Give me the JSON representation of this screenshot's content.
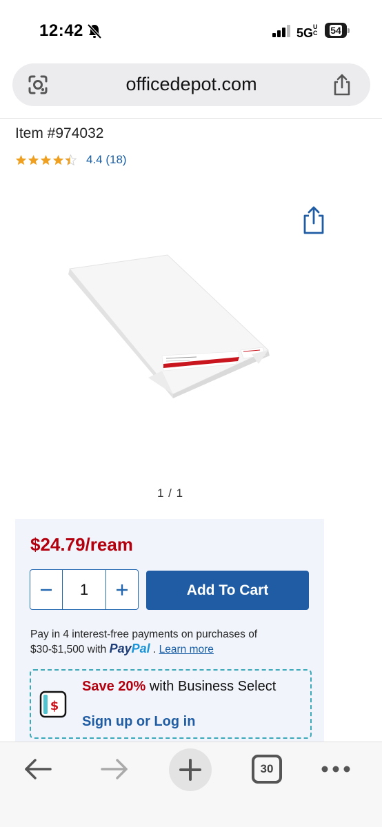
{
  "status": {
    "time": "12:42",
    "network": "5G",
    "network_suffix": "UC",
    "battery": "54"
  },
  "browser": {
    "url": "officedepot.com"
  },
  "product": {
    "item_number": "Item #974032",
    "rating_value": 4.4,
    "rating_text": "4.4 (18)",
    "gallery_count": "1 / 1"
  },
  "buy_box": {
    "price": "$24.79/ream",
    "quantity": "1",
    "add_to_cart_label": "Add To Cart",
    "paypal_text_before": "Pay in 4 interest-free payments on purchases of $30-$1,500 with",
    "paypal_brand_pay": "Pay",
    "paypal_brand_pal": "Pal",
    "paypal_separator": ".",
    "learn_more_label": "Learn more"
  },
  "promo": {
    "save_label": "Save 20%",
    "line_rest": " with Business Select",
    "cta_label": "Sign up or Log in"
  },
  "toolbar": {
    "tab_count": "30"
  },
  "colors": {
    "price_red": "#b3000f",
    "brand_blue": "#1f5ca3",
    "star_orange": "#f0a020",
    "promo_teal": "#3aa8b8"
  },
  "icons": [
    "bell-off-icon",
    "signal-icon",
    "battery-icon",
    "lens-icon",
    "share-icon",
    "star-icon",
    "minus-icon",
    "plus-icon",
    "dollar-icon",
    "back-arrow-icon",
    "forward-arrow-icon",
    "plus-icon",
    "ellipsis-icon"
  ]
}
